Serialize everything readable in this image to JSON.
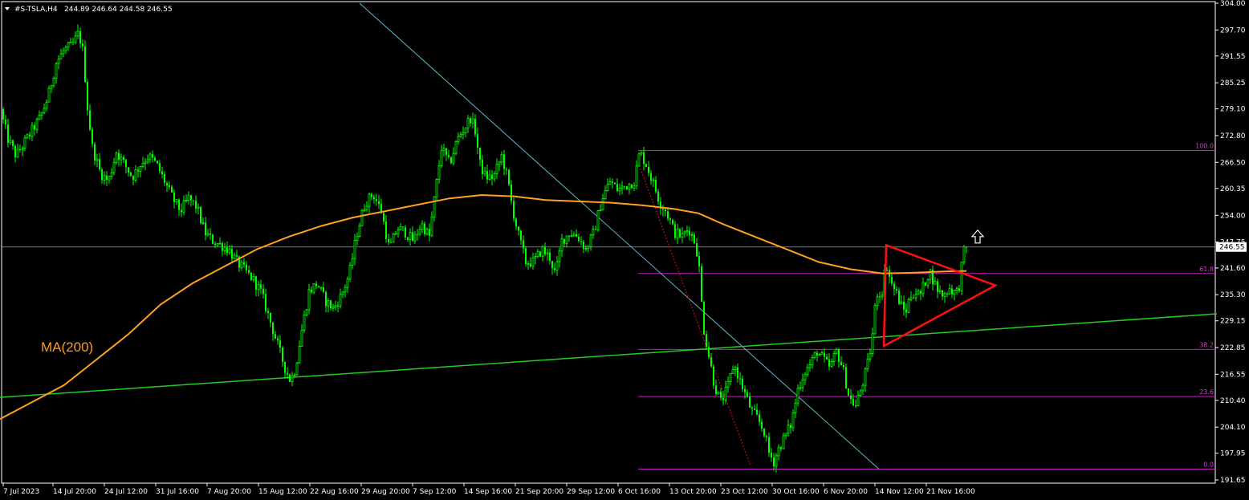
{
  "header": {
    "symbol": "#S-TSLA,H4",
    "ohlc": "244.89 246.64 244.58 246.55"
  },
  "ma_label": "MA(200)",
  "colors": {
    "background": "#000000",
    "candle": "#00ff00",
    "ma": "#ffa020",
    "trendline": "#22cc22",
    "channel_line": "#5fb8c8",
    "fib": "#c020c0",
    "triangle": "#ff1010",
    "dotted": "#e01010",
    "price_line": "#8aa9b8",
    "axis": "#ffffff"
  },
  "chart_data": {
    "type": "candlestick",
    "ylim": [
      191.65,
      304.0
    ],
    "y_ticks": [
      "304.00",
      "297.70",
      "291.55",
      "285.25",
      "279.10",
      "272.80",
      "266.50",
      "260.35",
      "254.00",
      "247.75",
      "241.60",
      "235.30",
      "229.15",
      "222.85",
      "216.55",
      "210.40",
      "204.10",
      "197.95",
      "191.65"
    ],
    "x_ticks": [
      "7 Jul 2023",
      "14 Jul 20:00",
      "24 Jul 12:00",
      "31 Jul 16:00",
      "7 Aug 20:00",
      "15 Aug 12:00",
      "22 Aug 16:00",
      "29 Aug 20:00",
      "7 Sep 12:00",
      "14 Sep 16:00",
      "21 Sep 20:00",
      "29 Sep 12:00",
      "6 Oct 16:00",
      "13 Oct 20:00",
      "23 Oct 12:00",
      "30 Oct 16:00",
      "6 Nov 20:00",
      "14 Nov 12:00",
      "21 Nov 16:00"
    ],
    "current_price": "246.55",
    "close_path": [
      [
        0,
        279
      ],
      [
        10,
        272
      ],
      [
        20,
        268
      ],
      [
        30,
        271
      ],
      [
        40,
        274
      ],
      [
        50,
        277
      ],
      [
        60,
        282
      ],
      [
        70,
        290
      ],
      [
        80,
        293
      ],
      [
        90,
        294
      ],
      [
        98,
        297
      ],
      [
        104,
        292
      ],
      [
        108,
        281
      ],
      [
        115,
        270
      ],
      [
        125,
        264
      ],
      [
        135,
        262
      ],
      [
        145,
        269
      ],
      [
        155,
        266
      ],
      [
        165,
        263
      ],
      [
        175,
        266
      ],
      [
        185,
        268
      ],
      [
        195,
        266
      ],
      [
        205,
        262
      ],
      [
        215,
        258
      ],
      [
        225,
        255
      ],
      [
        235,
        258
      ],
      [
        245,
        256
      ],
      [
        255,
        250
      ],
      [
        265,
        248
      ],
      [
        275,
        247
      ],
      [
        285,
        246
      ],
      [
        295,
        243
      ],
      [
        305,
        241
      ],
      [
        315,
        239
      ],
      [
        325,
        236
      ],
      [
        335,
        230
      ],
      [
        345,
        224
      ],
      [
        355,
        218
      ],
      [
        362,
        215
      ],
      [
        368,
        218
      ],
      [
        375,
        226
      ],
      [
        385,
        236
      ],
      [
        395,
        238
      ],
      [
        405,
        234
      ],
      [
        415,
        232
      ],
      [
        425,
        235
      ],
      [
        435,
        240
      ],
      [
        445,
        250
      ],
      [
        455,
        257
      ],
      [
        465,
        259
      ],
      [
        475,
        255
      ],
      [
        485,
        246
      ],
      [
        495,
        251
      ],
      [
        505,
        250
      ],
      [
        515,
        248
      ],
      [
        525,
        252
      ],
      [
        535,
        249
      ],
      [
        542,
        259
      ],
      [
        550,
        270
      ],
      [
        560,
        266
      ],
      [
        570,
        272
      ],
      [
        580,
        275
      ],
      [
        586,
        277
      ],
      [
        592,
        274
      ],
      [
        598,
        266
      ],
      [
        605,
        263
      ],
      [
        615,
        263
      ],
      [
        625,
        268
      ],
      [
        632,
        263
      ],
      [
        638,
        256
      ],
      [
        645,
        250
      ],
      [
        655,
        243
      ],
      [
        665,
        243
      ],
      [
        675,
        246
      ],
      [
        685,
        244
      ],
      [
        692,
        240
      ],
      [
        700,
        248
      ],
      [
        710,
        250
      ],
      [
        720,
        249
      ],
      [
        730,
        246
      ],
      [
        740,
        250
      ],
      [
        750,
        258
      ],
      [
        760,
        262
      ],
      [
        770,
        260
      ],
      [
        780,
        261
      ],
      [
        790,
        262
      ],
      [
        797,
        269
      ],
      [
        805,
        266
      ],
      [
        815,
        261
      ],
      [
        822,
        257
      ],
      [
        830,
        255
      ],
      [
        840,
        250
      ],
      [
        850,
        249
      ],
      [
        858,
        251
      ],
      [
        865,
        248
      ],
      [
        870,
        244
      ],
      [
        876,
        228
      ],
      [
        882,
        222
      ],
      [
        890,
        214
      ],
      [
        898,
        210
      ],
      [
        906,
        213
      ],
      [
        914,
        219
      ],
      [
        920,
        216
      ],
      [
        928,
        212
      ],
      [
        936,
        208
      ],
      [
        944,
        206
      ],
      [
        952,
        203
      ],
      [
        958,
        198
      ],
      [
        964,
        196
      ],
      [
        970,
        199
      ],
      [
        978,
        202
      ],
      [
        986,
        205
      ],
      [
        994,
        213
      ],
      [
        1002,
        217
      ],
      [
        1010,
        219
      ],
      [
        1018,
        222
      ],
      [
        1026,
        220
      ],
      [
        1034,
        218
      ],
      [
        1042,
        222
      ],
      [
        1050,
        218
      ],
      [
        1058,
        211
      ],
      [
        1066,
        209
      ],
      [
        1074,
        214
      ],
      [
        1080,
        218
      ],
      [
        1086,
        224
      ],
      [
        1092,
        236
      ],
      [
        1098,
        235
      ],
      [
        1104,
        243
      ],
      [
        1110,
        238
      ],
      [
        1116,
        236
      ],
      [
        1122,
        233
      ],
      [
        1128,
        231
      ],
      [
        1134,
        235
      ],
      [
        1140,
        236
      ],
      [
        1146,
        235
      ],
      [
        1152,
        238
      ],
      [
        1158,
        241
      ],
      [
        1164,
        238
      ],
      [
        1170,
        236
      ],
      [
        1176,
        235
      ],
      [
        1182,
        237
      ],
      [
        1188,
        236
      ],
      [
        1194,
        236
      ],
      [
        1200,
        245
      ],
      [
        1204,
        246.55
      ]
    ],
    "ma200": [
      [
        0,
        206
      ],
      [
        40,
        210
      ],
      [
        80,
        214
      ],
      [
        120,
        220
      ],
      [
        160,
        226
      ],
      [
        200,
        233
      ],
      [
        240,
        238
      ],
      [
        280,
        242
      ],
      [
        320,
        246
      ],
      [
        360,
        249
      ],
      [
        400,
        251.5
      ],
      [
        440,
        253.5
      ],
      [
        480,
        255
      ],
      [
        520,
        256.5
      ],
      [
        560,
        258
      ],
      [
        600,
        258.8
      ],
      [
        640,
        258.5
      ],
      [
        680,
        257.6
      ],
      [
        720,
        257.3
      ],
      [
        760,
        257
      ],
      [
        800,
        256.4
      ],
      [
        840,
        255.5
      ],
      [
        870,
        254.5
      ],
      [
        900,
        252
      ],
      [
        940,
        249
      ],
      [
        980,
        246
      ],
      [
        1020,
        243
      ],
      [
        1060,
        241.3
      ],
      [
        1100,
        240.3
      ],
      [
        1140,
        240.5
      ],
      [
        1180,
        240.8
      ],
      [
        1204,
        240.9
      ]
    ],
    "fibonacci": {
      "x_start": 795,
      "levels": [
        {
          "label": "100.0",
          "price": 269.3
        },
        {
          "label": "61.8",
          "price": 240.3
        },
        {
          "label": "38.2",
          "price": 222.4
        },
        {
          "label": "23.6",
          "price": 211.3
        },
        {
          "label": "0.0",
          "price": 194.2
        }
      ]
    },
    "support_line": {
      "x1": 0,
      "p1": 211.1,
      "x2": 1516,
      "p2": 230.8
    },
    "channel_line": {
      "x1": 448,
      "p1": 304,
      "x2": 1095,
      "p2": 194.2
    },
    "dotted_line": {
      "x1": 795,
      "p1": 266.5,
      "x2": 935,
      "p2": 195
    },
    "triangle": {
      "apex": [
        1240,
        237.5
      ],
      "top": [
        1104,
        247.0
      ],
      "bottom": [
        1101,
        223.2
      ]
    },
    "arrow": {
      "x": 1218,
      "price": 249.0
    }
  }
}
